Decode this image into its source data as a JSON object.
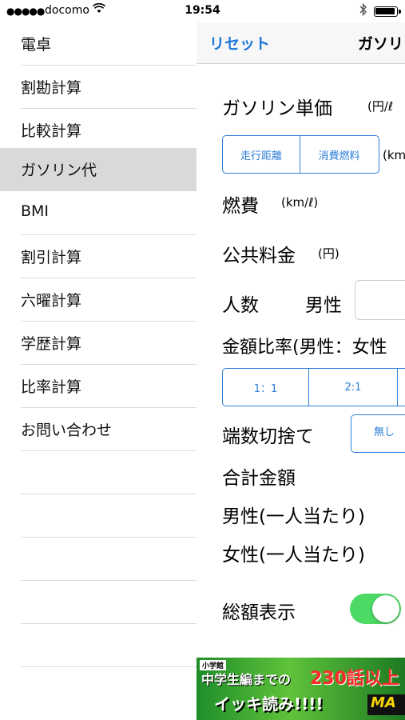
{
  "status_bar": {
    "signal": "●●●●●",
    "carrier": "docomo",
    "time": "19:54"
  },
  "sidebar": {
    "items": [
      {
        "label": "電卓",
        "selected": false
      },
      {
        "label": "割勘計算",
        "selected": false
      },
      {
        "label": "比較計算",
        "selected": false
      },
      {
        "label": "ガソリン代",
        "selected": true
      },
      {
        "label": "BMI",
        "selected": false
      },
      {
        "label": "割引計算",
        "selected": false
      },
      {
        "label": "六曜計算",
        "selected": false
      },
      {
        "label": "学歴計算",
        "selected": false
      },
      {
        "label": "比率計算",
        "selected": false
      },
      {
        "label": "お問い合わせ",
        "selected": false
      },
      {
        "label": "",
        "selected": false
      },
      {
        "label": "",
        "selected": false
      },
      {
        "label": "",
        "selected": false
      },
      {
        "label": "",
        "selected": false
      },
      {
        "label": "",
        "selected": false
      }
    ]
  },
  "navbar": {
    "reset_label": "リセット",
    "title": "ガソリ"
  },
  "form": {
    "gas_price_label": "ガソリン単価",
    "gas_price_unit": "(円/ℓ",
    "distance_tab": "走行距離",
    "fuel_tab": "消費燃料",
    "distance_unit": "(km",
    "fuel_economy_label": "燃費",
    "fuel_economy_unit": "(km/ℓ)",
    "public_fee_label": "公共料金",
    "public_fee_unit": "(円)",
    "people_label": "人数",
    "male_label": "男性",
    "ratio_label": "金額比率(男性：女性",
    "ratio_options": [
      "1：1",
      "2:1",
      ""
    ],
    "rounding_label": "端数切捨て",
    "rounding_option": "無し",
    "total_label": "合計金額",
    "male_per_person_label": "男性(一人当たり)",
    "female_per_person_label": "女性(一人当たり)",
    "total_display_label": "総額表示",
    "total_display_on": true
  },
  "ad": {
    "badge": "小学館",
    "line1": "中学生編までの",
    "highlight": "230話以上",
    "line2": "イッキ読み!!!!",
    "logo": "MA"
  },
  "colors": {
    "accent": "#2d7ed9",
    "selected_row": "#d9d9d9",
    "toggle_on": "#4cd964"
  }
}
